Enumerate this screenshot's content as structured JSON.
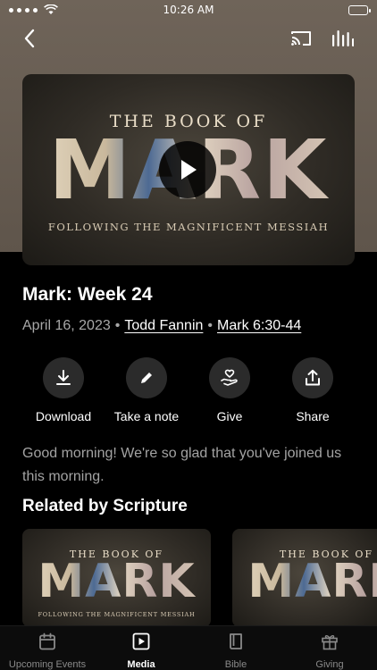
{
  "status_bar": {
    "time": "10:26 AM"
  },
  "header": {
    "back_icon": "chevron-left-icon",
    "cast_icon": "cast-icon",
    "audio_icon": "audio-bars-icon"
  },
  "artwork": {
    "top_text": "THE BOOK OF",
    "big_text": "MARK",
    "bottom_text": "FOLLOWING THE MAGNIFICENT MESSIAH"
  },
  "sermon": {
    "title": "Mark: Week 24",
    "date": "April 16, 2023",
    "speaker": "Todd Fannin",
    "scripture": "Mark 6:30-44",
    "description": "Good morning! We're so glad that you've joined us this morning."
  },
  "actions": [
    {
      "label": "Download",
      "icon": "download-icon"
    },
    {
      "label": "Take a note",
      "icon": "pencil-icon"
    },
    {
      "label": "Give",
      "icon": "heart-hand-icon"
    },
    {
      "label": "Share",
      "icon": "share-icon"
    }
  ],
  "related": {
    "title": "Related by Scripture",
    "items": [
      {
        "top_text": "THE BOOK OF",
        "big_text": "MARK",
        "bottom_text": "FOLLOWING THE MAGNIFICENT MESSIAH"
      },
      {
        "top_text": "THE BOOK OF",
        "big_text": "MARK",
        "bottom_text": ""
      }
    ]
  },
  "tabs": [
    {
      "label": "Upcoming Events",
      "icon": "calendar-icon",
      "active": false
    },
    {
      "label": "Media",
      "icon": "play-square-icon",
      "active": true
    },
    {
      "label": "Bible",
      "icon": "book-icon",
      "active": false
    },
    {
      "label": "Giving",
      "icon": "gift-icon",
      "active": false
    }
  ]
}
